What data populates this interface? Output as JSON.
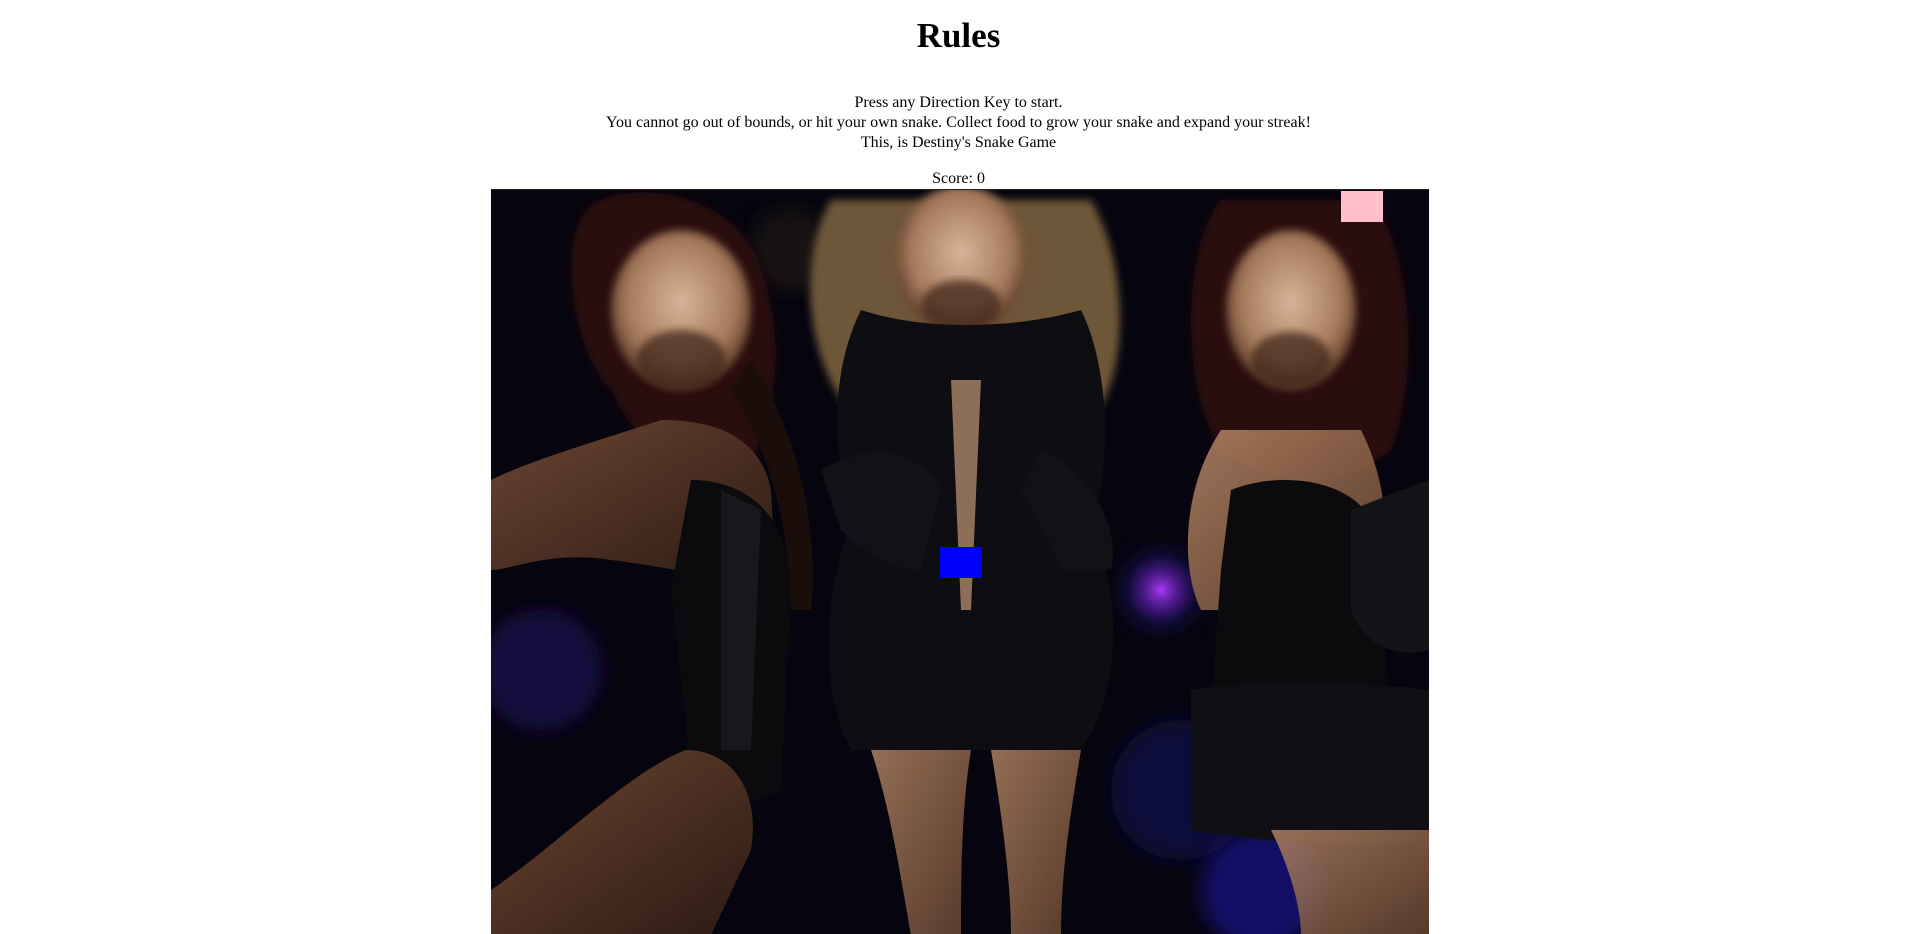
{
  "header": {
    "title": "Rules"
  },
  "rules": {
    "line1": "Press any Direction Key to start.",
    "line2": "You cannot go out of bounds, or hit your own snake. Collect food to grow your snake and expand your streak!",
    "line3": "This, is Destiny's Snake Game"
  },
  "score": {
    "text": "Score: 0"
  },
  "game": {
    "background_description_icon": "performers-photo-background",
    "snake_color": "#0000ff",
    "food_color": "#ffc0cb"
  }
}
